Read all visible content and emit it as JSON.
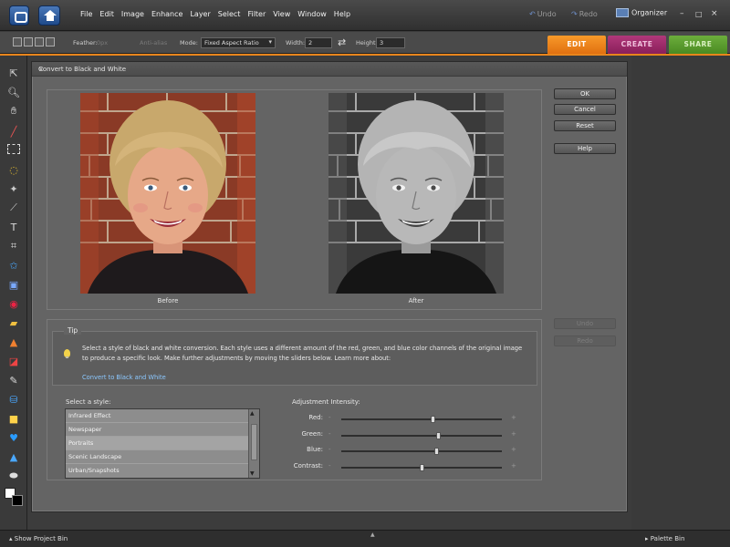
{
  "menu": {
    "items": [
      "File",
      "Edit",
      "Image",
      "Enhance",
      "Layer",
      "Select",
      "Filter",
      "View",
      "Window",
      "Help"
    ],
    "undo": "Undo",
    "redo": "Redo",
    "organizer": "Organizer",
    "minimize": "–",
    "maximize": "□",
    "close": "×"
  },
  "options": {
    "feather_label": "Feather:",
    "feather_value": "0px",
    "antialias_label": "Anti-alias",
    "mode_label": "Mode:",
    "mode_value": "Fixed Aspect Ratio",
    "width_label": "Width:",
    "width_value": "2",
    "height_label": "Height:",
    "height_value": "3"
  },
  "tabs": {
    "edit": "EDIT",
    "create": "CREATE",
    "share": "SHARE"
  },
  "dialog": {
    "title": "Convert to Black and White",
    "close": "×",
    "before_label": "Before",
    "after_label": "After",
    "buttons": {
      "ok": "OK",
      "cancel": "Cancel",
      "reset": "Reset",
      "help": "Help",
      "undo": "Undo",
      "redo": "Redo"
    },
    "tip": {
      "label": "Tip",
      "text": "Select a style of black and white conversion. Each style uses a different amount of the red, green, and blue color channels of the original image to produce a specific look. Make further adjustments by moving the sliders below. Learn more about:",
      "link": "Convert to Black and White"
    },
    "style_label": "Select a style:",
    "styles": [
      "Infrared Effect",
      "Newspaper",
      "Portraits",
      "Scenic Landscape",
      "Urban/Snapshots"
    ],
    "selected_style": "Portraits",
    "adjustment_label": "Adjustment Intensity:",
    "sliders": [
      {
        "name": "Red:",
        "min": "-",
        "max": "+",
        "value": 0.57
      },
      {
        "name": "Green:",
        "min": "-",
        "max": "+",
        "value": 0.6
      },
      {
        "name": "Blue:",
        "min": "-",
        "max": "+",
        "value": 0.59
      },
      {
        "name": "Contrast:",
        "min": "-",
        "max": "+",
        "value": 0.5
      }
    ]
  },
  "bottom": {
    "project_bin": "Show Project Bin",
    "palette_bin": "Palette Bin",
    "center_mark": "▲"
  },
  "colors": {
    "edit_tab": "#e8851c",
    "create_tab": "#9c2a6a",
    "share_tab": "#5a9c2c",
    "link": "#8cc8ff",
    "foreground": "#ffffff",
    "background": "#000000"
  }
}
